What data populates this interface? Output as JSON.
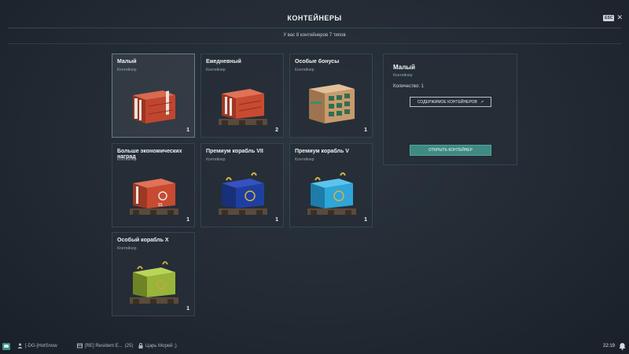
{
  "header": {
    "title": "КОНТЕЙНЕРЫ",
    "esc_label": "ESC",
    "close_glyph": "✕",
    "subtitle": "У вас 8 контейнеров 7 типов"
  },
  "containers": [
    {
      "name": "Малый",
      "type": "Контейнер",
      "count": "1",
      "color": "#b8432c"
    },
    {
      "name": "Ежедневный",
      "type": "Контейнер",
      "count": "2",
      "color": "#c0462e"
    },
    {
      "name": "Особые бонусы",
      "type": "Контейнер",
      "count": "1",
      "color": "#c89a6c"
    },
    {
      "name": "Больше экономических наград",
      "type": "Контейнер",
      "count": "1",
      "color": "#b8432c"
    },
    {
      "name": "Премиум корабль VII",
      "type": "Контейнер",
      "count": "1",
      "color": "#1f3fa0"
    },
    {
      "name": "Премиум корабль V",
      "type": "Контейнер",
      "count": "1",
      "color": "#2ea6d8"
    },
    {
      "name": "Особый корабль X",
      "type": "Контейнер",
      "count": "1",
      "color": "#98b53a"
    }
  ],
  "details": {
    "name": "Малый",
    "type": "Контейнер",
    "quantity": "Количество: 1",
    "contents_button": "СОДЕРЖИМОЕ КОНТЕЙНЕРОВ",
    "contents_icon": "↗",
    "open_button": "ОТКРЫТЬ КОНТЕЙНЕР"
  },
  "bottombar": {
    "player": "[-DG-]HotSnow",
    "clan": "[RE] Resident E...",
    "clan_count": "(25)",
    "division": "Царь Морей ;)",
    "time": "22:19"
  },
  "colors": {
    "accent": "#3f8a83",
    "panel": "#262e37"
  }
}
